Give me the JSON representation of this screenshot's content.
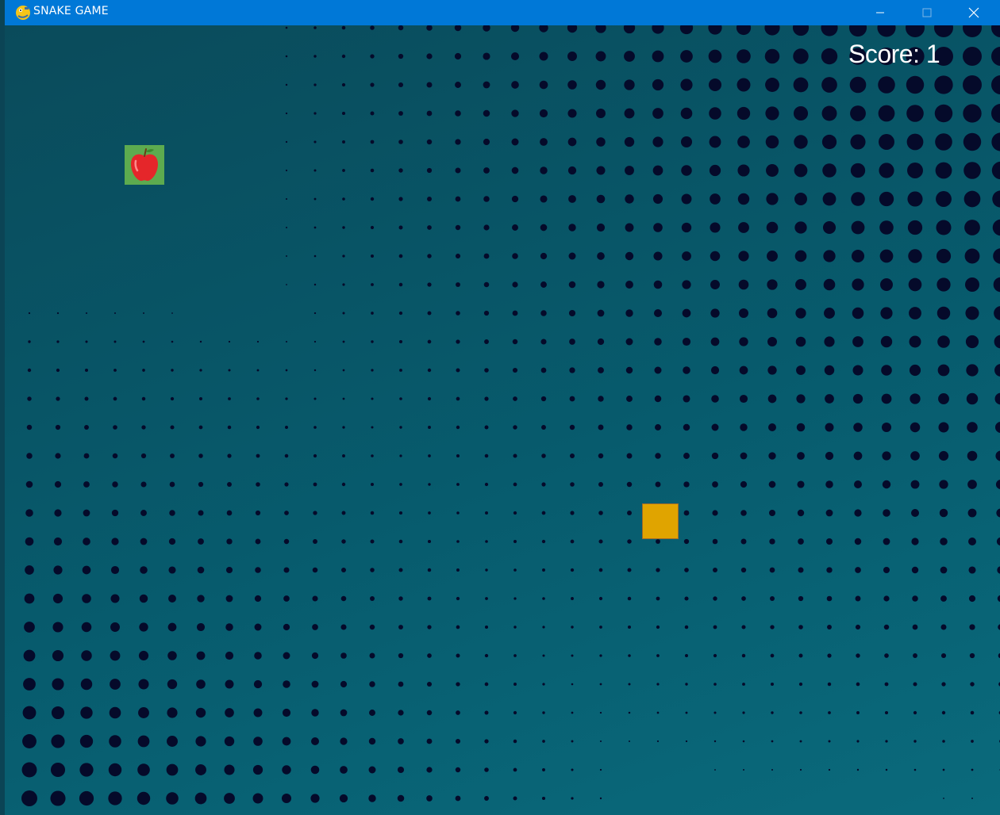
{
  "window": {
    "title": "SNAKE GAME",
    "app_icon": "python-snake-icon",
    "titlebar_color": "#0078d7",
    "controls": {
      "minimize_icon": "minimize-icon",
      "maximize_icon": "maximize-icon",
      "close_icon": "close-icon"
    }
  },
  "game": {
    "score_text": "Score: 1",
    "score_value": 1,
    "food": {
      "icon": "apple-icon",
      "tile_color": "#5dab4f",
      "apple_color": "#e5262a"
    },
    "snake": {
      "length": 1,
      "head_color": "#e0a400"
    },
    "background": {
      "base_color": "#075b6d",
      "dot_color": "#050a2a",
      "pattern": "halftone dots"
    }
  }
}
